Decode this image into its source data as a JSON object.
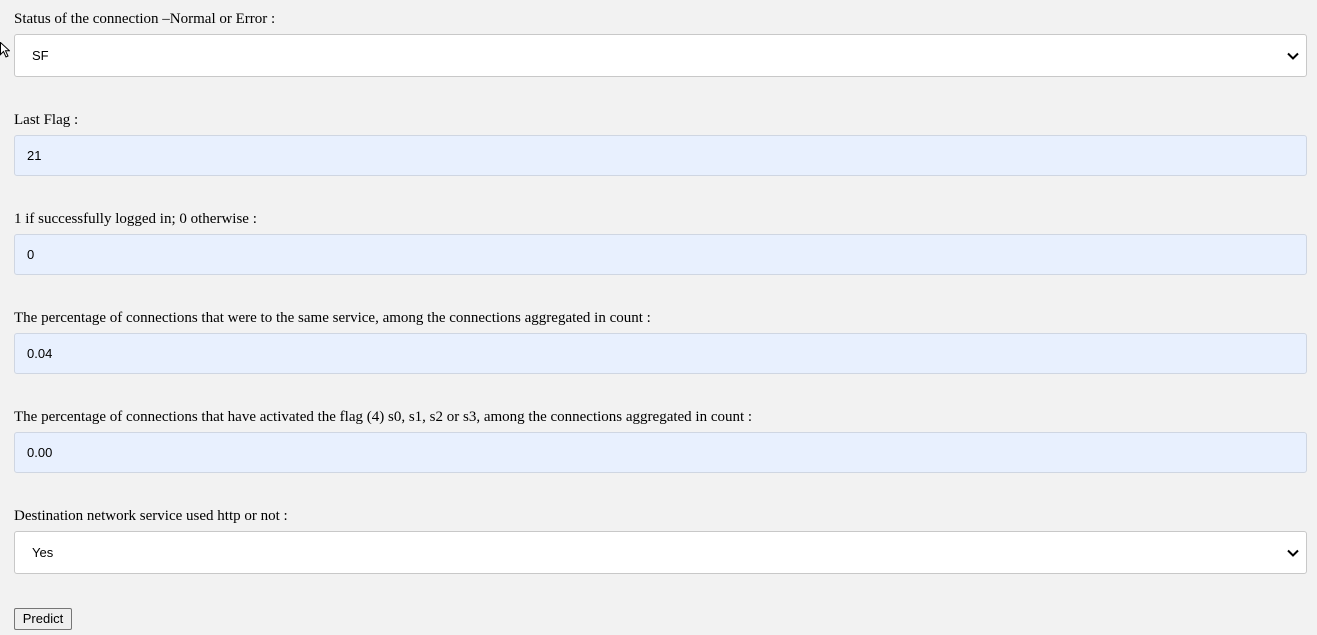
{
  "form": {
    "fields": [
      {
        "label": "Status of the connection –Normal or Error :",
        "type": "select",
        "value": "SF"
      },
      {
        "label": "Last Flag :",
        "type": "input",
        "value": "21"
      },
      {
        "label": "1 if successfully logged in; 0 otherwise :",
        "type": "input",
        "value": "0"
      },
      {
        "label": "The percentage of connections that were to the same service, among the connections aggregated in count :",
        "type": "input",
        "value": "0.04"
      },
      {
        "label": "The percentage of connections that have activated the flag (4) s0, s1, s2 or s3, among the connections aggregated in count :",
        "type": "input",
        "value": "0.00"
      },
      {
        "label": "Destination network service used http or not :",
        "type": "select",
        "value": "Yes"
      }
    ],
    "submit_label": "Predict"
  },
  "colors": {
    "page_background": "#f2f2f2",
    "autofill_input_background": "#e8f0fe",
    "select_background": "#ffffff"
  },
  "icons": {
    "select_arrow": "chevron-down-icon",
    "mouse_pointer": "cursor-arrow-icon"
  }
}
